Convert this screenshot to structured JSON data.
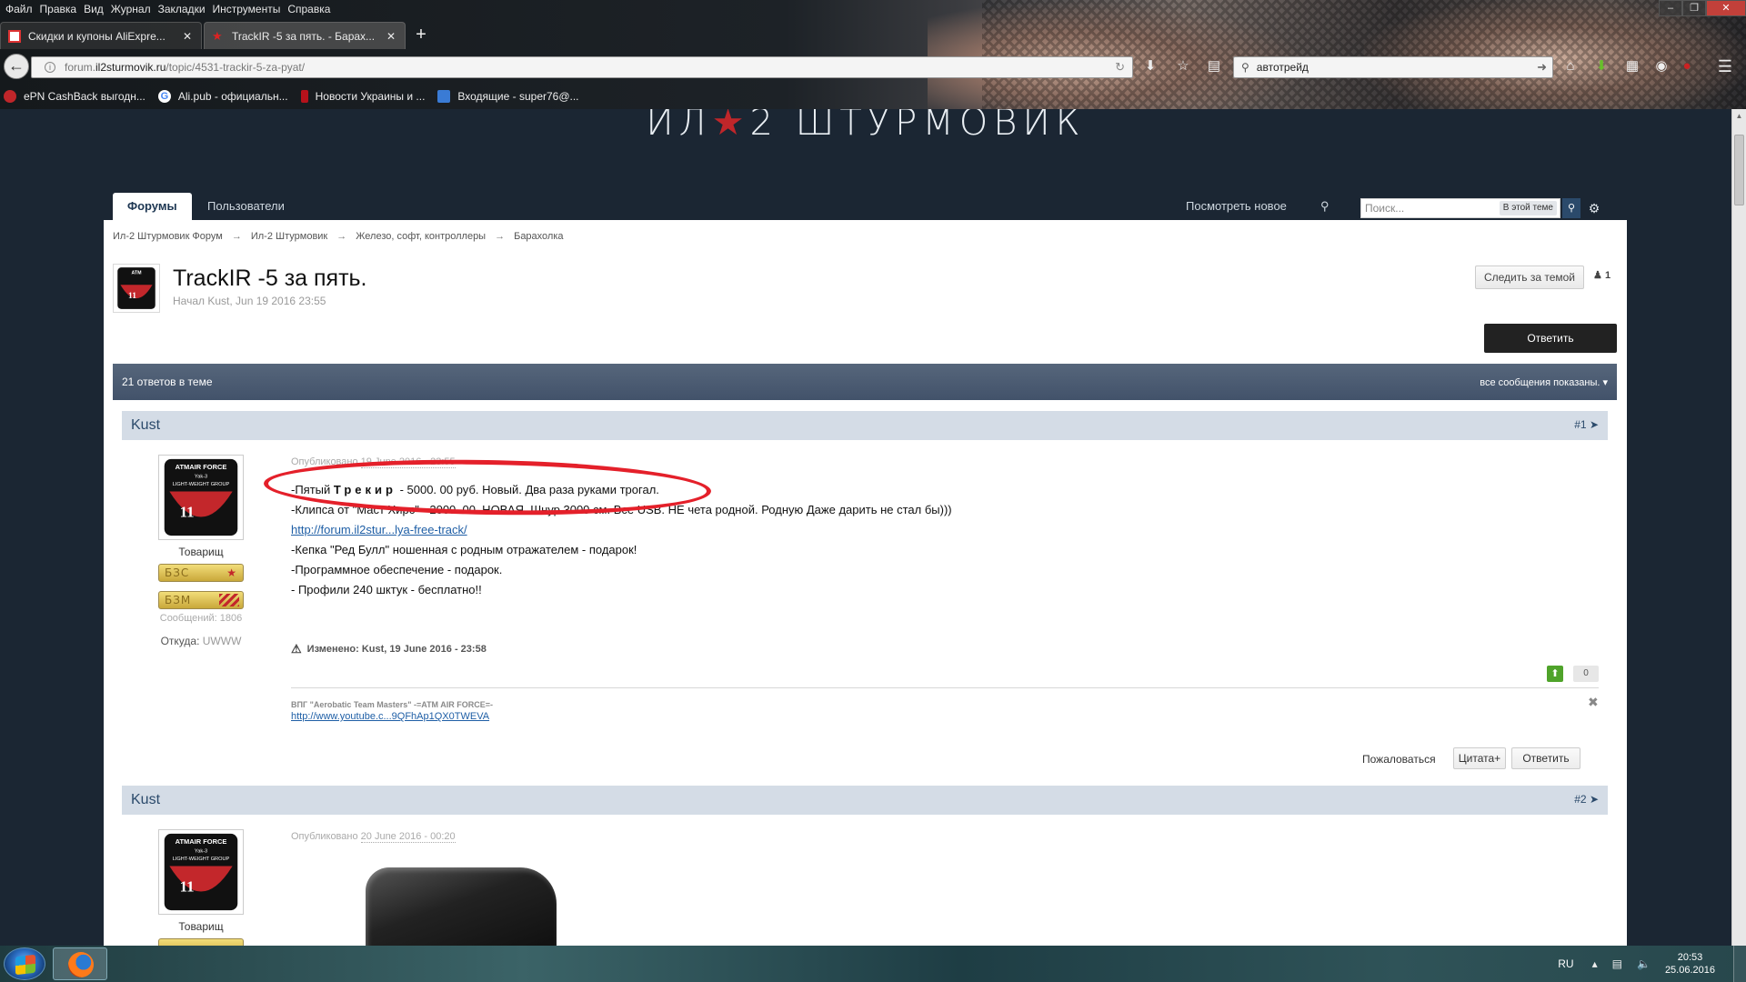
{
  "browser": {
    "menu": [
      "Файл",
      "Правка",
      "Вид",
      "Журнал",
      "Закладки",
      "Инструменты",
      "Справка"
    ],
    "tabs": [
      {
        "label": "Скидки и купоны AliExpre...",
        "close": "✕",
        "icon": "aliexpress-icon",
        "active": false
      },
      {
        "label": "TrackIR -5 за пять. - Барах...",
        "close": "✕",
        "icon": "red-star-icon",
        "active": true
      }
    ],
    "new_tab": "+",
    "url_host": "forum.",
    "url_domain": "il2sturmovik.ru",
    "url_path": "/topic/4531-trackir-5-za-pyat/",
    "search_value": "автотрейд",
    "bookmarks": [
      {
        "label": "ePN CashBack выгодн...",
        "icon": "epn-icon",
        "color": "#c0262a"
      },
      {
        "label": "Ali.pub - официальн...",
        "icon": "google-icon",
        "color": "#ffffff"
      },
      {
        "label": "Новости Украины и ...",
        "icon": "news-icon",
        "color": "#b5121b"
      },
      {
        "label": "Входящие - super76@...",
        "icon": "mail-icon",
        "color": "#3a7bd5"
      }
    ]
  },
  "site": {
    "logo_left": "ИЛ",
    "logo_star": "★",
    "logo_right": "2 ШТУРМОВИК"
  },
  "forum": {
    "nav_forums": "Форумы",
    "nav_users": "Пользователи",
    "view_new": "Посмотреть новое",
    "search_placeholder": "Поиск...",
    "search_scope": "В этой теме",
    "breadcrumbs": [
      "Ил-2 Штурмовик Форум",
      "Ил-2 Штурмовик",
      "Железо, софт, контроллеры",
      "Барахолка"
    ],
    "breadcrumb_sep": "→",
    "topic_title": "TrackIR -5 за пять.",
    "topic_meta": "Начал Kust, Jun 19 2016 23:55",
    "follow_label": "Следить за темой",
    "followers": "1",
    "reply_label": "Ответить",
    "reply_count": "21 ответов в теме",
    "filter_label": "все сообщения показаны."
  },
  "posts": [
    {
      "author": "Kust",
      "number": "#1",
      "avatar_lines": [
        "ATMAIR FORCE",
        "Yak-3",
        "LIGHT-WEIGHT GROUP",
        "11"
      ],
      "rank": "Товарищ",
      "badges": [
        "БЗС",
        "БЗМ"
      ],
      "posts_label": "Сообщений:",
      "posts_count": "1806",
      "from_label": "Откуда:",
      "from_value": "UWWW",
      "date_label": "Опубликовано",
      "date": "19 June 2016 - 23:55",
      "line1_a": "-Пятый ",
      "line1_b": "Трекир",
      "line1_c": " - 5000. 00 руб. Новый. Два раза руками трогал.",
      "line2": "-Клипса от \"Маст Хирс\" - 2000. 00. НОВАЯ. Шнур 3000 см. Все USB. НЕ чета родной. Родную Даже дарить не стал бы)))",
      "link": "http://forum.il2stur...lya-free-track/",
      "line4": "-Кепка \"Ред Булл\" ношенная с родным отражателем  - подарок!",
      "line5": "-Программное обеспечение - подарок.",
      "line6": " - Профили 240 шктук - бесплатно!!",
      "edited": "Изменено: Kust, 19 June 2016 - 23:58",
      "rep": "0",
      "sig_title": "ВПГ \"Aerobatic Team Masters\" -=ATM AIR FORCE=-",
      "sig_link": "http://www.youtube.c...9QFhAp1QX0TWEVA",
      "report": "Пожаловаться",
      "quote": "Цитата+",
      "reply": "Ответить"
    },
    {
      "author": "Kust",
      "number": "#2",
      "avatar_lines": [
        "ATMAIR FORCE",
        "Yak-3",
        "LIGHT-WEIGHT GROUP",
        "11"
      ],
      "rank": "Товарищ",
      "date_label": "Опубликовано",
      "date": "20 June 2016 - 00:20"
    }
  ],
  "taskbar": {
    "lang": "RU",
    "time": "20:53",
    "date": "25.06.2016"
  },
  "colors": {
    "page_bg": "#1b2633",
    "post_head": "#d4dce6",
    "link": "#1f5fa6",
    "highlight_ring": "#e4202a"
  }
}
